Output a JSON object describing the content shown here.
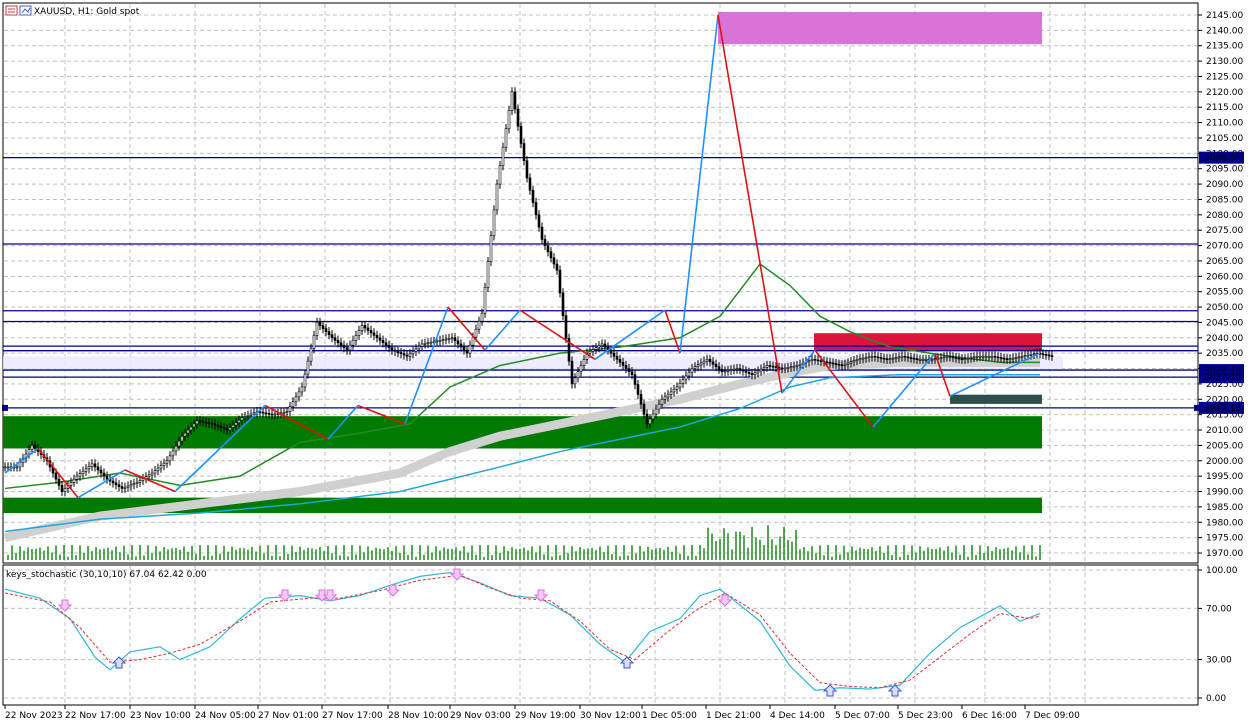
{
  "header": {
    "symbol_text": "XAUUSD, H1:  Gold spot"
  },
  "indicator": {
    "label": "keys_stochastic (30,10,10) 67.04 62.42 0.00"
  },
  "price_axis": {
    "ticks": [
      "2145.00",
      "2140.00",
      "2135.00",
      "2130.00",
      "2125.00",
      "2120.00",
      "2115.00",
      "2110.00",
      "2105.00",
      "2100.00",
      "2095.00",
      "2090.00",
      "2085.00",
      "2080.00",
      "2075.00",
      "2070.00",
      "2065.00",
      "2060.00",
      "2055.00",
      "2050.00",
      "2045.00",
      "2040.00",
      "2035.00",
      "2030.00",
      "2025.00",
      "2020.00",
      "2015.00",
      "2010.00",
      "2005.00",
      "2000.00",
      "1995.00",
      "1990.00",
      "1985.00",
      "1980.00",
      "1975.00",
      "1970.00"
    ],
    "tag_current": "2017.18",
    "tag_other": [
      "2098.59",
      "2029.48",
      "2027.25"
    ]
  },
  "stoch_axis": {
    "ticks": [
      "100.00",
      "70.00",
      "30.00",
      "0.00"
    ]
  },
  "time_axis": {
    "labels": [
      "22 Nov 2023",
      "22 Nov 17:00",
      "23 Nov 10:00",
      "24 Nov 05:00",
      "27 Nov 01:00",
      "27 Nov 17:00",
      "28 Nov 10:00",
      "29 Nov 03:00",
      "29 Nov 19:00",
      "30 Nov 12:00",
      "1 Dec 05:00",
      "1 Dec 21:00",
      "4 Dec 14:00",
      "5 Dec 07:00",
      "5 Dec 23:00",
      "6 Dec 16:00",
      "7 Dec 09:00"
    ]
  },
  "colors": {
    "grid": "#c0c0c0",
    "line_blue": "#00008b",
    "zone_green": "#007a00",
    "zone_magenta": "#d873d8",
    "zone_red": "#dc143c",
    "zigzag_up": "#1e90ff",
    "zigzag_down": "#e01010",
    "ma_green": "#228b22",
    "ma_cyan": "#1fa7e0",
    "stoch_main": "#2fb8d8",
    "stoch_signal": "#e03030",
    "arrow_pink": "#e070e0",
    "arrow_blue": "#4050e0"
  },
  "chart_data": {
    "type": "candlestick",
    "series": [
      {
        "name": "close",
        "x": [
          0,
          15,
          30,
          45,
          60,
          75,
          90,
          105,
          120,
          135,
          150,
          165,
          180,
          195,
          210,
          225,
          240,
          255,
          270,
          285,
          300,
          315,
          330,
          345,
          360,
          375,
          390,
          405,
          420,
          435,
          450,
          465,
          480,
          495,
          510,
          525,
          540,
          555,
          570,
          585,
          600,
          615,
          630,
          645,
          660,
          675,
          690,
          705,
          720,
          735,
          750,
          765,
          780,
          795,
          810,
          825,
          840,
          855,
          870,
          885,
          900,
          915,
          930,
          945,
          960,
          975,
          990,
          1005,
          1020,
          1035
        ],
        "values": [
          1998,
          2005,
          2000,
          1990,
          1995,
          1999,
          1994,
          1991,
          1993,
          1996,
          2000,
          2008,
          2013,
          2012,
          2010,
          2014,
          2016,
          2015,
          2016,
          2024,
          2045,
          2040,
          2036,
          2044,
          2040,
          2036,
          2034,
          2038,
          2039,
          2040,
          2035,
          2048,
          2090,
          2120,
          2092,
          2072,
          2062,
          2025,
          2035,
          2038,
          2033,
          2028,
          2012,
          2020,
          2024,
          2030,
          2033,
          2029,
          2030,
          2028,
          2031,
          2030,
          2031,
          2033,
          2032,
          2031,
          2033,
          2034,
          2033,
          2034,
          2033,
          2033,
          2034,
          2033,
          2034,
          2034,
          2033,
          2034,
          2035,
          2034
        ]
      }
    ]
  }
}
